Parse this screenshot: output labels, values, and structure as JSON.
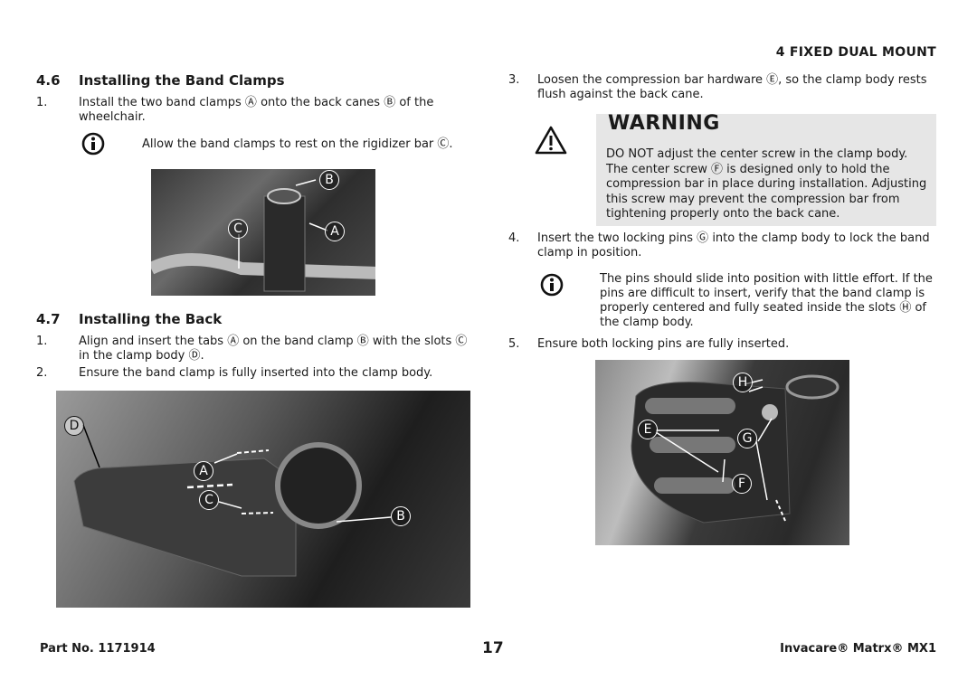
{
  "header": {
    "chapter": "4 FIXED DUAL MOUNT"
  },
  "left": {
    "section_46": {
      "number": "4.6",
      "title": "Installing the Band Clamps",
      "steps": [
        {
          "n": "1.",
          "text": "Install the two band clamps Ⓐ onto the back canes Ⓑ of the wheelchair."
        }
      ],
      "note": "Allow the band clamps to rest on the rigidizer bar Ⓒ.",
      "photo_callouts": [
        "B",
        "C",
        "A"
      ]
    },
    "section_47": {
      "number": "4.7",
      "title": "Installing the Back",
      "steps": [
        {
          "n": "1.",
          "text": "Align and insert the tabs Ⓐ on the band clamp Ⓑ with the slots Ⓒ in the clamp body Ⓓ."
        },
        {
          "n": "2.",
          "text": "Ensure the band clamp is fully inserted into the clamp body."
        }
      ],
      "photo_callouts": [
        "D",
        "A",
        "C",
        "B"
      ]
    }
  },
  "right": {
    "steps": [
      {
        "n": "3.",
        "text": "Loosen the compression bar hardware Ⓔ, so the clamp body rests flush against the back cane."
      },
      {
        "n": "4.",
        "text": "Insert the two locking pins Ⓖ into the clamp body to lock the band clamp in position."
      },
      {
        "n": "5.",
        "text": "Ensure both locking pins are fully inserted."
      }
    ],
    "warning": {
      "title": "WARNING",
      "text": "DO NOT adjust the center screw in the clamp body. The center screw Ⓕ is designed only to hold the compression bar in place during installation. Adjusting this screw may prevent the compression bar from tightening properly onto the back cane."
    },
    "note": "The pins should slide into position with little effort. If the pins are difficult to insert, verify that the band clamp is properly centered and fully seated inside the slots Ⓗ of the clamp body.",
    "photo_callouts": [
      "H",
      "E",
      "G",
      "F"
    ]
  },
  "footer": {
    "part_no": "Part No. 1171914",
    "page": "17",
    "product": "Invacare® Matrx® MX1"
  }
}
